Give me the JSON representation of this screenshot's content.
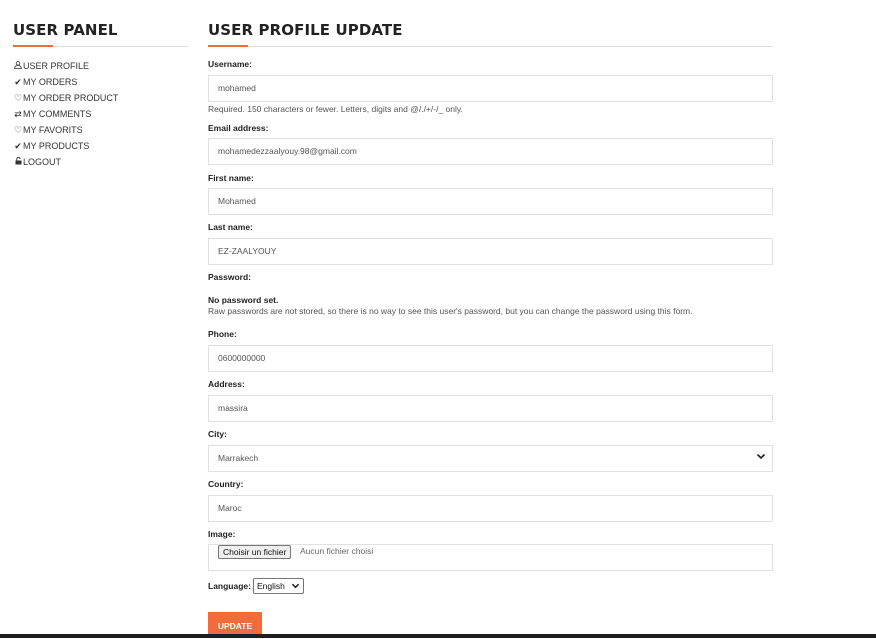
{
  "sidebar": {
    "title": "USER PANEL",
    "items": [
      {
        "icon": "user-icon",
        "glyph": "&",
        "label": "USER PROFILE"
      },
      {
        "icon": "check-icon",
        "glyph": "✔",
        "label": "MY ORDERS"
      },
      {
        "icon": "heart-icon",
        "glyph": "♡",
        "label": "MY ORDER PRODUCT"
      },
      {
        "icon": "exchange-icon",
        "glyph": "⇄",
        "label": "MY COMMENTS"
      },
      {
        "icon": "heart-icon",
        "glyph": "♡",
        "label": "MY FAVORITS"
      },
      {
        "icon": "check-icon",
        "glyph": "✔",
        "label": "MY PRODUCTS"
      },
      {
        "icon": "lock-icon",
        "glyph": "🔓",
        "label": "LOGOUT"
      }
    ]
  },
  "form": {
    "title": "USER PROFILE UPDATE",
    "username": {
      "label": "Username:",
      "value": "mohamed",
      "help": "Required. 150 characters or fewer. Letters, digits and @/./+/-/_ only."
    },
    "email": {
      "label": "Email address:",
      "value": "mohamedezzaalyouy.98@gmail.com"
    },
    "first_name": {
      "label": "First name:",
      "value": "Mohamed"
    },
    "last_name": {
      "label": "Last name:",
      "value": "EZ-ZAALYOUY"
    },
    "password": {
      "label": "Password:",
      "status": "No password set.",
      "help": "Raw passwords are not stored, so there is no way to see this user's password, but you can change the password using this form."
    },
    "phone": {
      "label": "Phone:",
      "value": "0600000000"
    },
    "address": {
      "label": "Address:",
      "value": "massira"
    },
    "city": {
      "label": "City:",
      "value": "Marrakech"
    },
    "country": {
      "label": "Country:",
      "value": "Maroc"
    },
    "image": {
      "label": "Image:",
      "button": "Choisir un fichier",
      "status": "Aucun fichier choisi"
    },
    "language": {
      "label": "Language:",
      "value": "English"
    },
    "submit_label": "UPDATE"
  },
  "colors": {
    "accent": "#f26b3a"
  }
}
